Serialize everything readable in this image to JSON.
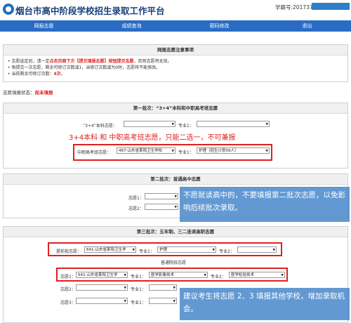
{
  "header": {
    "title": "烟台市高中阶段学校招生录取工作平台",
    "id_label": "学籍号:201737"
  },
  "nav": [
    "网报志愿",
    "成绩查询",
    "密码修改",
    "退出"
  ],
  "notice": {
    "title": "网报志愿注意事项",
    "items": [
      {
        "pre": "志愿选定后，请一定",
        "red": "点击页面下方【提交填报志愿】按钮提交志愿",
        "post": "，否则志愿将无效。"
      },
      {
        "pre": "每提交一次志愿，剩余可修订次数减1，当修订次数减为0时，志愿将不能修改。",
        "red": "",
        "post": ""
      },
      {
        "pre": "当前剩余可修订次数：",
        "red": "4次",
        "post": "。"
      }
    ]
  },
  "status": {
    "label": "志愿填报状态：",
    "value": "尚未填报"
  },
  "batch1": {
    "title": "第一批次：“3+4”本科和中职高考班志愿",
    "row1": {
      "label": "“3+4”本科志愿：",
      "major_label": "专业1：",
      "school": "",
      "major": ""
    },
    "banner": "3+4本科 和 中职高考班志愿，只能二选一，不可兼报",
    "row2": {
      "label": "中职高考班志愿：",
      "school": "467-山东省莱阳卫生学校",
      "major_label": "专业1：",
      "major": "护理（招生计划59人）"
    }
  },
  "batch2": {
    "title": "第二批次：普通高中志愿",
    "labels": [
      "志愿1：",
      "志愿2："
    ],
    "tip": "不愿就读高中的，不要填报第二批次志愿，以免影响后续批次录取。"
  },
  "batch3": {
    "title": "第三批次：五年制、三二连读高职志愿",
    "early": {
      "label": "提前批志愿：",
      "school": "641-山东省莱阳卫生学",
      "major1_label": "专业1：",
      "major1": "护理",
      "major2_label": "专业2：",
      "major2": ""
    },
    "sub_title": "普通院校志愿",
    "rows": [
      {
        "label": "志愿1：",
        "school": "641-山东省莱阳卫生学",
        "major1_label": "专业1：",
        "major1": "医学影像技术",
        "major2_label": "专业2：",
        "major2": "医学检验技术"
      },
      {
        "label": "志愿2：",
        "school": "",
        "major1_label": "专业1：",
        "major1": "",
        "major2_label": "",
        "major2": ""
      },
      {
        "label": "志愿3：",
        "school": "",
        "major1_label": "专业1：",
        "major1": "",
        "major2_label": "",
        "major2": ""
      }
    ],
    "tip": "建议考生将志愿 2、3 填报其他学校，增加录取机会。"
  },
  "colors": {
    "nav": "#2a6cc4",
    "accent_red": "#e02020",
    "tip_bg": "#4182c8",
    "title": "#1a3f7a"
  }
}
